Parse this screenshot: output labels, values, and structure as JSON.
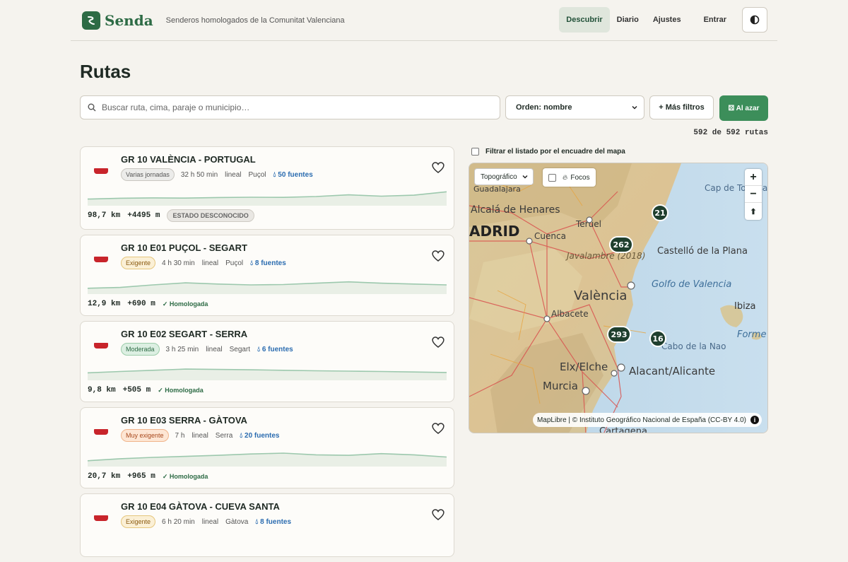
{
  "header": {
    "brand": "Senda",
    "tagline": "Senderos homologados de la Comunitat Valenciana",
    "nav": [
      {
        "label": "Descubrir",
        "active": true
      },
      {
        "label": "Diario",
        "active": false
      },
      {
        "label": "Ajustes",
        "active": false
      }
    ],
    "login": "Entrar",
    "theme_icon": "contrast-icon"
  },
  "page": {
    "title": "Rutas"
  },
  "controls": {
    "search_placeholder": "Buscar ruta, cima, paraje o municipio…",
    "sort_label": "Orden: nombre",
    "more_filters": "+ Más filtros",
    "random": "⚄ Al azar"
  },
  "count": "592 de 592 rutas",
  "routes": [
    {
      "title": "GR 10 VALÈNCIA - PORTUGAL",
      "badge": "Varias jornadas",
      "badge_tone": "gray",
      "duration": "32 h 50 min",
      "type": "lineal",
      "town": "Puçol",
      "sources": "50 fuentes",
      "distance": "98,7 km",
      "gain": "+4495 m",
      "status": "ESTADO DESCONOCIDO",
      "status_kind": "unknown",
      "profile": [
        0.35,
        0.4,
        0.42,
        0.41,
        0.44,
        0.46,
        0.45,
        0.5,
        0.6,
        0.52,
        0.58,
        0.78
      ]
    },
    {
      "title": "GR 10 E01 PUÇOL - SEGART",
      "badge": "Exigente",
      "badge_tone": "amber",
      "duration": "4 h 30 min",
      "type": "lineal",
      "town": "Puçol",
      "sources": "8 fuentes",
      "distance": "12,9 km",
      "gain": "+690 m",
      "status": "✓ Homologada",
      "status_kind": "homologated",
      "profile": [
        0.3,
        0.35,
        0.5,
        0.62,
        0.55,
        0.5,
        0.52,
        0.6,
        0.68,
        0.6,
        0.55,
        0.5
      ]
    },
    {
      "title": "GR 10 E02 SEGART - SERRA",
      "badge": "Moderada",
      "badge_tone": "green",
      "duration": "3 h 25 min",
      "type": "lineal",
      "town": "Segart",
      "sources": "6 fuentes",
      "distance": "9,8 km",
      "gain": "+505 m",
      "status": "✓ Homologada",
      "status_kind": "homologated",
      "profile": [
        0.4,
        0.48,
        0.55,
        0.62,
        0.6,
        0.58,
        0.55,
        0.52,
        0.5,
        0.48,
        0.45,
        0.42
      ]
    },
    {
      "title": "GR 10 E03 SERRA - GÀTOVA",
      "badge": "Muy exigente",
      "badge_tone": "orange",
      "duration": "7 h",
      "type": "lineal",
      "town": "Serra",
      "sources": "20 fuentes",
      "distance": "20,7 km",
      "gain": "+965 m",
      "status": "✓ Homologada",
      "status_kind": "homologated",
      "profile": [
        0.3,
        0.42,
        0.5,
        0.56,
        0.62,
        0.7,
        0.75,
        0.65,
        0.62,
        0.72,
        0.65,
        0.52
      ]
    },
    {
      "title": "GR 10 E04 GÀTOVA - CUEVA SANTA",
      "badge": "Exigente",
      "badge_tone": "amber",
      "duration": "6 h 20 min",
      "type": "lineal",
      "town": "Gàtova",
      "sources": "8 fuentes",
      "distance": "",
      "gain": "",
      "status": "",
      "status_kind": "",
      "profile": []
    }
  ],
  "map": {
    "filter_label": "Filtrar el listado por el encuadre del mapa",
    "layer": "Topográfico",
    "focos": "Focos",
    "attribution": "MapLibre | © Instituto Geográfico Nacional de España (CC-BY 4.0)",
    "cities": [
      "Guadalajara",
      "Alcalá de Henares",
      "ADRID",
      "Teruel",
      "Cuenca",
      "Javalambre (2018)",
      "Castelló de la Plana",
      "Golfo de Valencia",
      "València",
      "Albacete",
      "Cap de Tortosa",
      "Ibiza",
      "Forme",
      "Cabo de la Nao",
      "Elx/Elche",
      "Alacant/Alicante",
      "Murcia",
      "Cartagena"
    ],
    "clusters": [
      "21",
      "262",
      "293",
      "16"
    ]
  },
  "colors": {
    "accent": "#3c8e5a",
    "brand": "#2d6b45",
    "flag": "#c8242b",
    "sources": "#2b6cb0"
  }
}
